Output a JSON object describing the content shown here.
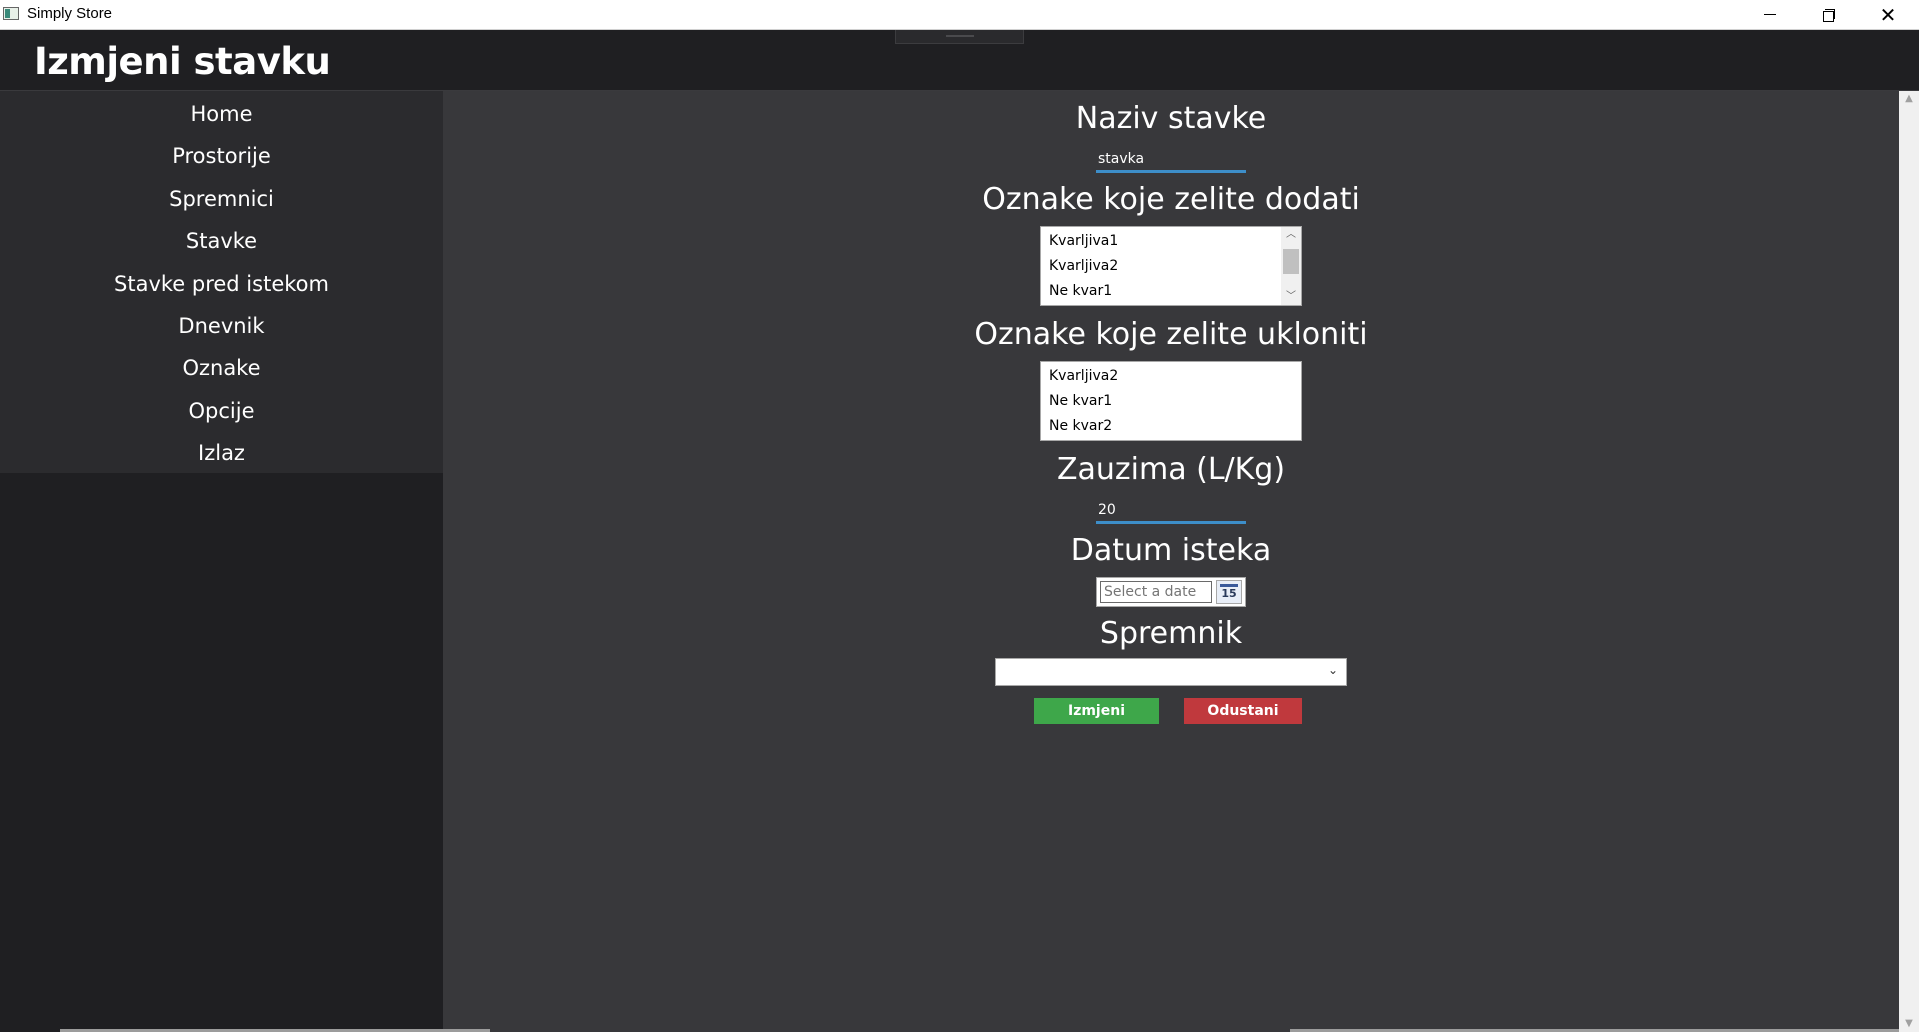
{
  "window": {
    "title": "Simply Store",
    "minimize": "minimize",
    "maximize": "restore",
    "close": "✕"
  },
  "header": {
    "title": "Izmjeni stavku"
  },
  "sidebar": {
    "items": [
      {
        "label": "Home"
      },
      {
        "label": "Prostorije"
      },
      {
        "label": "Spremnici"
      },
      {
        "label": "Stavke"
      },
      {
        "label": "Stavke pred istekom"
      },
      {
        "label": "Dnevnik"
      },
      {
        "label": "Oznake"
      },
      {
        "label": "Opcije"
      },
      {
        "label": "Izlaz"
      }
    ]
  },
  "form": {
    "name": {
      "label": "Naziv stavke",
      "value": "stavka"
    },
    "tags_add": {
      "label": "Oznake koje zelite dodati",
      "items": [
        "Kvarljiva1",
        "Kvarljiva2",
        "Ne kvar1"
      ]
    },
    "tags_remove": {
      "label": "Oznake koje zelite ukloniti",
      "items": [
        "Kvarljiva2",
        "Ne kvar1",
        "Ne kvar2"
      ]
    },
    "volume": {
      "label": "Zauzima (L/Kg)",
      "value": "20"
    },
    "expiry": {
      "label": "Datum isteka",
      "placeholder": "Select a date",
      "calendar_day": "15"
    },
    "container": {
      "label": "Spremnik",
      "value": ""
    },
    "save_label": "Izmjeni",
    "cancel_label": "Odustani"
  },
  "colors": {
    "background": "#38383b",
    "sidebar": "#2b2b2e",
    "header": "#1f1f22",
    "accent_underline": "#3d8ec9",
    "save": "#3ea74a",
    "cancel": "#c0393d"
  }
}
